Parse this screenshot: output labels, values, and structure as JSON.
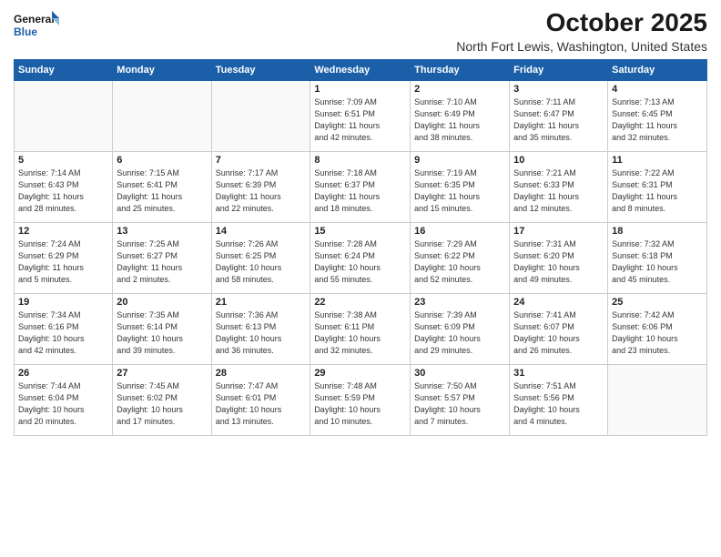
{
  "logo": {
    "line1": "General",
    "line2": "Blue"
  },
  "title": "October 2025",
  "location": "North Fort Lewis, Washington, United States",
  "days_of_week": [
    "Sunday",
    "Monday",
    "Tuesday",
    "Wednesday",
    "Thursday",
    "Friday",
    "Saturday"
  ],
  "weeks": [
    [
      {
        "day": "",
        "info": ""
      },
      {
        "day": "",
        "info": ""
      },
      {
        "day": "",
        "info": ""
      },
      {
        "day": "1",
        "info": "Sunrise: 7:09 AM\nSunset: 6:51 PM\nDaylight: 11 hours\nand 42 minutes."
      },
      {
        "day": "2",
        "info": "Sunrise: 7:10 AM\nSunset: 6:49 PM\nDaylight: 11 hours\nand 38 minutes."
      },
      {
        "day": "3",
        "info": "Sunrise: 7:11 AM\nSunset: 6:47 PM\nDaylight: 11 hours\nand 35 minutes."
      },
      {
        "day": "4",
        "info": "Sunrise: 7:13 AM\nSunset: 6:45 PM\nDaylight: 11 hours\nand 32 minutes."
      }
    ],
    [
      {
        "day": "5",
        "info": "Sunrise: 7:14 AM\nSunset: 6:43 PM\nDaylight: 11 hours\nand 28 minutes."
      },
      {
        "day": "6",
        "info": "Sunrise: 7:15 AM\nSunset: 6:41 PM\nDaylight: 11 hours\nand 25 minutes."
      },
      {
        "day": "7",
        "info": "Sunrise: 7:17 AM\nSunset: 6:39 PM\nDaylight: 11 hours\nand 22 minutes."
      },
      {
        "day": "8",
        "info": "Sunrise: 7:18 AM\nSunset: 6:37 PM\nDaylight: 11 hours\nand 18 minutes."
      },
      {
        "day": "9",
        "info": "Sunrise: 7:19 AM\nSunset: 6:35 PM\nDaylight: 11 hours\nand 15 minutes."
      },
      {
        "day": "10",
        "info": "Sunrise: 7:21 AM\nSunset: 6:33 PM\nDaylight: 11 hours\nand 12 minutes."
      },
      {
        "day": "11",
        "info": "Sunrise: 7:22 AM\nSunset: 6:31 PM\nDaylight: 11 hours\nand 8 minutes."
      }
    ],
    [
      {
        "day": "12",
        "info": "Sunrise: 7:24 AM\nSunset: 6:29 PM\nDaylight: 11 hours\nand 5 minutes."
      },
      {
        "day": "13",
        "info": "Sunrise: 7:25 AM\nSunset: 6:27 PM\nDaylight: 11 hours\nand 2 minutes."
      },
      {
        "day": "14",
        "info": "Sunrise: 7:26 AM\nSunset: 6:25 PM\nDaylight: 10 hours\nand 58 minutes."
      },
      {
        "day": "15",
        "info": "Sunrise: 7:28 AM\nSunset: 6:24 PM\nDaylight: 10 hours\nand 55 minutes."
      },
      {
        "day": "16",
        "info": "Sunrise: 7:29 AM\nSunset: 6:22 PM\nDaylight: 10 hours\nand 52 minutes."
      },
      {
        "day": "17",
        "info": "Sunrise: 7:31 AM\nSunset: 6:20 PM\nDaylight: 10 hours\nand 49 minutes."
      },
      {
        "day": "18",
        "info": "Sunrise: 7:32 AM\nSunset: 6:18 PM\nDaylight: 10 hours\nand 45 minutes."
      }
    ],
    [
      {
        "day": "19",
        "info": "Sunrise: 7:34 AM\nSunset: 6:16 PM\nDaylight: 10 hours\nand 42 minutes."
      },
      {
        "day": "20",
        "info": "Sunrise: 7:35 AM\nSunset: 6:14 PM\nDaylight: 10 hours\nand 39 minutes."
      },
      {
        "day": "21",
        "info": "Sunrise: 7:36 AM\nSunset: 6:13 PM\nDaylight: 10 hours\nand 36 minutes."
      },
      {
        "day": "22",
        "info": "Sunrise: 7:38 AM\nSunset: 6:11 PM\nDaylight: 10 hours\nand 32 minutes."
      },
      {
        "day": "23",
        "info": "Sunrise: 7:39 AM\nSunset: 6:09 PM\nDaylight: 10 hours\nand 29 minutes."
      },
      {
        "day": "24",
        "info": "Sunrise: 7:41 AM\nSunset: 6:07 PM\nDaylight: 10 hours\nand 26 minutes."
      },
      {
        "day": "25",
        "info": "Sunrise: 7:42 AM\nSunset: 6:06 PM\nDaylight: 10 hours\nand 23 minutes."
      }
    ],
    [
      {
        "day": "26",
        "info": "Sunrise: 7:44 AM\nSunset: 6:04 PM\nDaylight: 10 hours\nand 20 minutes."
      },
      {
        "day": "27",
        "info": "Sunrise: 7:45 AM\nSunset: 6:02 PM\nDaylight: 10 hours\nand 17 minutes."
      },
      {
        "day": "28",
        "info": "Sunrise: 7:47 AM\nSunset: 6:01 PM\nDaylight: 10 hours\nand 13 minutes."
      },
      {
        "day": "29",
        "info": "Sunrise: 7:48 AM\nSunset: 5:59 PM\nDaylight: 10 hours\nand 10 minutes."
      },
      {
        "day": "30",
        "info": "Sunrise: 7:50 AM\nSunset: 5:57 PM\nDaylight: 10 hours\nand 7 minutes."
      },
      {
        "day": "31",
        "info": "Sunrise: 7:51 AM\nSunset: 5:56 PM\nDaylight: 10 hours\nand 4 minutes."
      },
      {
        "day": "",
        "info": ""
      }
    ]
  ]
}
